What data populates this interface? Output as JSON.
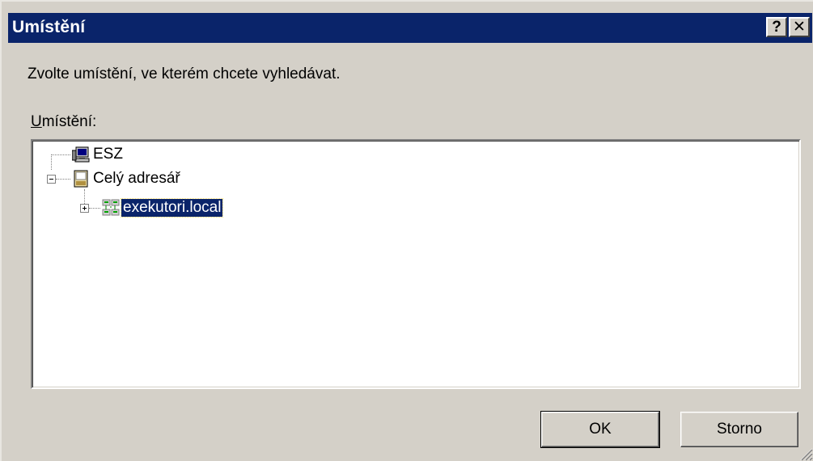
{
  "window": {
    "title": "Umístění",
    "help_label": "?",
    "close_label": "✕"
  },
  "instruction": "Zvolte umístění, ve kterém chcete vyhledávat.",
  "location_label": {
    "accel": "U",
    "rest": "místění:"
  },
  "tree": {
    "nodes": [
      {
        "label": "ESZ",
        "icon": "computer-icon"
      },
      {
        "label": "Celý adresář",
        "icon": "directory-icon",
        "expanded": true
      },
      {
        "label": "exekutori.local",
        "icon": "domain-icon",
        "expanded": false,
        "selected": true
      }
    ]
  },
  "buttons": {
    "ok": "OK",
    "cancel": "Storno"
  },
  "colors": {
    "titlebar": "#0a246a",
    "face": "#d4d0c8",
    "selection": "#0a246a"
  }
}
